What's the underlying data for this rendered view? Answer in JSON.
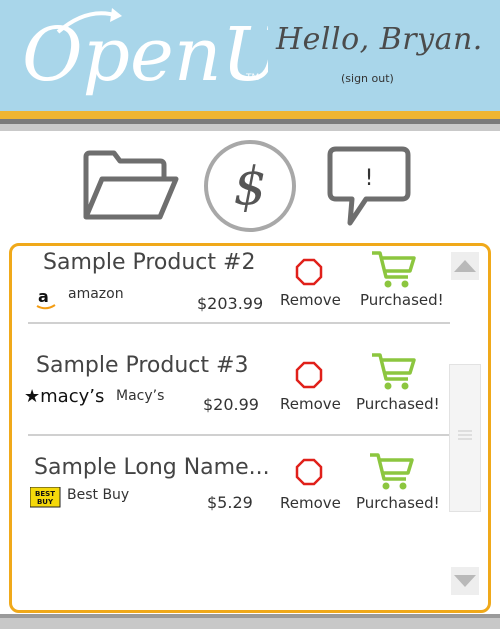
{
  "header": {
    "logo_text": "OpenUp",
    "logo_tm": "TM",
    "greeting": "Hello, Bryan.",
    "sign_out": "(sign out)"
  },
  "nav": {
    "folder_icon": "folder-icon",
    "dollar_icon": "dollar-icon",
    "dollar_symbol": "$",
    "alert_icon": "speech-alert-icon",
    "alert_symbol": "!"
  },
  "products": [
    {
      "name": "Sample Product #2",
      "store": "amazon",
      "store_logo": "amazon-logo-icon",
      "price": "$203.99",
      "remove": "Remove",
      "purchased": "Purchased!"
    },
    {
      "name": "Sample Product #3",
      "store": "Macy’s",
      "store_logo_text": "★macy’s",
      "price": "$20.99",
      "remove": "Remove",
      "purchased": "Purchased!"
    },
    {
      "name": "Sample Long Name...",
      "store": "Best Buy",
      "store_logo_text": "BEST BUY",
      "price": "$5.29",
      "remove": "Remove",
      "purchased": "Purchased!"
    }
  ],
  "colors": {
    "header_bg": "#a9d6ea",
    "accent_orange": "#f0a91a",
    "remove_red": "#e0201a",
    "cart_green": "#8cc63f"
  }
}
